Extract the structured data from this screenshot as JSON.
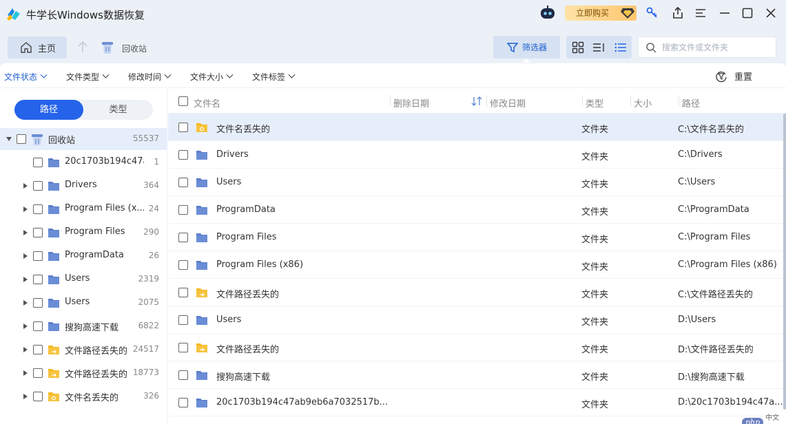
{
  "app": {
    "title": "牛学长Windows数据恢复",
    "buy_label": "立即购买"
  },
  "toolbar": {
    "home_label": "主页",
    "breadcrumb": "回收站",
    "filter_label": "筛选器",
    "search_placeholder": "搜索文件或文件夹"
  },
  "filters": {
    "items": [
      "文件状态",
      "文件类型",
      "修改时间",
      "文件大小",
      "文件标签"
    ],
    "reset_label": "重置"
  },
  "left": {
    "tab_path": "路径",
    "tab_type": "类型",
    "tree": [
      {
        "label": "回收站",
        "count": "55537",
        "icon": "recycle-bin-icon",
        "expanded": true,
        "selected": true,
        "level": 0
      },
      {
        "label": "20c1703b194c47a...",
        "count": "1",
        "icon": "folder-icon",
        "expander": false,
        "level": 1
      },
      {
        "label": "Drivers",
        "count": "364",
        "icon": "folder-icon",
        "expander": true,
        "level": 1
      },
      {
        "label": "Program Files (x...",
        "count": "24",
        "icon": "folder-icon",
        "expander": true,
        "level": 1
      },
      {
        "label": "Program Files",
        "count": "290",
        "icon": "folder-icon",
        "expander": true,
        "level": 1
      },
      {
        "label": "ProgramData",
        "count": "26",
        "icon": "folder-icon",
        "expander": true,
        "level": 1
      },
      {
        "label": "Users",
        "count": "2319",
        "icon": "folder-icon",
        "expander": true,
        "level": 1
      },
      {
        "label": "Users",
        "count": "2075",
        "icon": "folder-icon",
        "expander": true,
        "level": 1
      },
      {
        "label": "搜狗高速下载",
        "count": "6822",
        "icon": "folder-icon",
        "expander": true,
        "level": 1
      },
      {
        "label": "文件路径丢失的",
        "count": "24517",
        "icon": "lost-path-folder-icon",
        "expander": true,
        "level": 1
      },
      {
        "label": "文件路径丢失的",
        "count": "18773",
        "icon": "lost-path-folder-icon",
        "expander": true,
        "level": 1
      },
      {
        "label": "文件名丢失的",
        "count": "326",
        "icon": "lost-name-folder-icon",
        "expander": true,
        "level": 1
      }
    ]
  },
  "table": {
    "headers": {
      "name": "文件名",
      "deleted": "删除日期",
      "modified": "修改日期",
      "type": "类型",
      "size": "大小",
      "path": "路径"
    },
    "rows": [
      {
        "name": "文件名丢失的",
        "type": "文件夹",
        "path": "C:\\文件名丢失的",
        "icon": "lost-name-folder-icon",
        "selected": true
      },
      {
        "name": "Drivers",
        "type": "文件夹",
        "path": "C:\\Drivers",
        "icon": "folder-icon"
      },
      {
        "name": "Users",
        "type": "文件夹",
        "path": "C:\\Users",
        "icon": "folder-icon"
      },
      {
        "name": "ProgramData",
        "type": "文件夹",
        "path": "C:\\ProgramData",
        "icon": "folder-icon"
      },
      {
        "name": "Program Files",
        "type": "文件夹",
        "path": "C:\\Program Files",
        "icon": "folder-icon"
      },
      {
        "name": "Program Files (x86)",
        "type": "文件夹",
        "path": "C:\\Program Files (x86)",
        "icon": "folder-icon"
      },
      {
        "name": "文件路径丢失的",
        "type": "文件夹",
        "path": "C:\\文件路径丢失的",
        "icon": "lost-path-folder-icon"
      },
      {
        "name": "Users",
        "type": "文件夹",
        "path": "D:\\Users",
        "icon": "folder-icon"
      },
      {
        "name": "文件路径丢失的",
        "type": "文件夹",
        "path": "D:\\文件路径丢失的",
        "icon": "lost-path-folder-icon"
      },
      {
        "name": "搜狗高速下载",
        "type": "文件夹",
        "path": "D:\\搜狗高速下载",
        "icon": "folder-icon"
      },
      {
        "name": "20c1703b194c47ab9eb6a7032517b...",
        "type": "文件夹",
        "path": "D:\\20c1703b194c47a...",
        "icon": "folder-icon"
      }
    ]
  },
  "watermark": {
    "badge": "php",
    "text": "中文网"
  },
  "colors": {
    "accent": "#2563eb",
    "folder_blue": "#5b7fc9",
    "folder_yellow": "#f5b821",
    "selected_row": "#e7eefb"
  }
}
